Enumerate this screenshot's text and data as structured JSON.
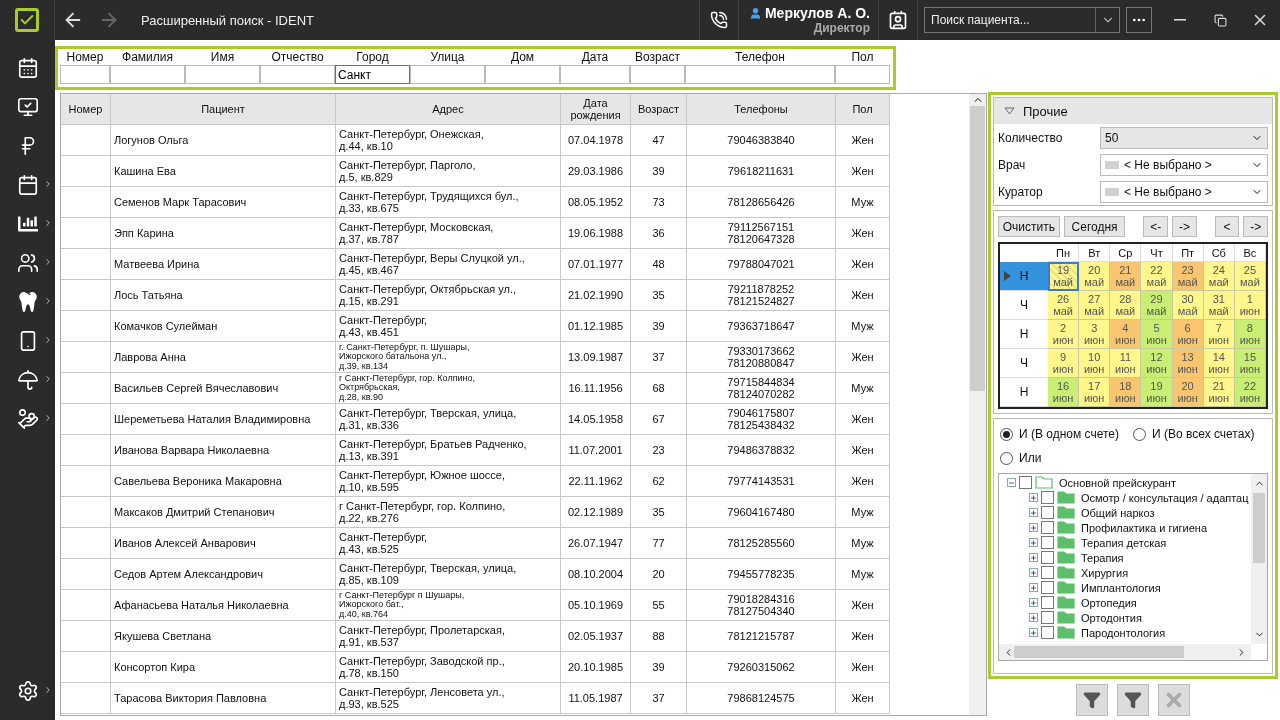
{
  "app_bar": {
    "title": "Расширенный поиск - IDENT",
    "back_disabled": false,
    "forward_disabled": true,
    "user_name": "Меркулов А. О.",
    "user_role": "Директор",
    "search": {
      "placeholder": "Поиск пациента..."
    }
  },
  "sidebar": {
    "items": [
      {
        "kind": "calendar-grid",
        "submenu": false
      },
      {
        "kind": "monitor-check",
        "submenu": false
      },
      {
        "kind": "ruble",
        "submenu": false
      },
      {
        "kind": "calendar",
        "submenu": true
      },
      {
        "kind": "chart",
        "submenu": true
      },
      {
        "kind": "people",
        "submenu": true
      },
      {
        "kind": "tooth",
        "submenu": true
      },
      {
        "kind": "phone",
        "submenu": true
      },
      {
        "kind": "umbrella",
        "submenu": true
      },
      {
        "kind": "ruble-hand",
        "submenu": true
      }
    ],
    "footer": {
      "kind": "settings",
      "submenu": true
    }
  },
  "filters": [
    {
      "label": "Номер",
      "focused": false
    },
    {
      "label": "Фамилия",
      "focused": false
    },
    {
      "label": "Имя",
      "focused": false
    },
    {
      "label": "Отчество",
      "focused": false
    },
    {
      "label": "Город",
      "value": "Санкт",
      "focused": true
    },
    {
      "label": "Улица",
      "focused": false
    },
    {
      "label": "Дом",
      "focused": false
    },
    {
      "label": "Дата",
      "focused": false
    },
    {
      "label": "Возраст",
      "focused": false
    },
    {
      "label": "Телефон",
      "focused": false
    },
    {
      "label": "Пол",
      "focused": false
    }
  ],
  "table": {
    "columns": [
      "Номер",
      "Пациент",
      "Адрес",
      "Дата рождения",
      "Возраст",
      "Телефоны",
      "Пол"
    ],
    "rows": [
      {
        "patient": "Логунов Ольга",
        "address": [
          "Санкт-Петербург, Онежская,",
          "д.44, кв.10"
        ],
        "birth_date": "07.04.1978",
        "age": "47",
        "phones": [
          "79046383840"
        ],
        "sex": "Жен"
      },
      {
        "patient": "Кашина Ева",
        "address": [
          "Санкт-Петербург, Парголо,",
          "д.5, кв.829"
        ],
        "birth_date": "29.03.1986",
        "age": "39",
        "phones": [
          "79618211631"
        ],
        "sex": "Жен"
      },
      {
        "patient": "Семенов Марк Тарасович",
        "address": [
          "Санкт-Петербург, Трудящихся бул.,",
          "д.33, кв.675"
        ],
        "birth_date": "08.05.1952",
        "age": "73",
        "phones": [
          "78128656426"
        ],
        "sex": "Муж"
      },
      {
        "patient": "Эпп Карина",
        "address": [
          "Санкт-Петербург, Московская,",
          "д.37, кв.787"
        ],
        "birth_date": "19.06.1988",
        "age": "36",
        "phones": [
          "79112567151",
          "78120647328"
        ],
        "sex": "Жен"
      },
      {
        "patient": "Матвеева Ирина",
        "address": [
          "Санкт-Петербург, Веры Слуцкой ул.,",
          "д.45, кв.467"
        ],
        "birth_date": "07.01.1977",
        "age": "48",
        "phones": [
          "79788047021"
        ],
        "sex": "Жен"
      },
      {
        "patient": "Лось Татьяна",
        "address": [
          "Санкт-Петербург, Октябрьская ул.,",
          "д.15, кв.291"
        ],
        "birth_date": "21.02.1990",
        "age": "35",
        "phones": [
          "79211878252",
          "78121524827"
        ],
        "sex": "Жен"
      },
      {
        "patient": "Комачков Сулейман",
        "address": [
          "Санкт-Петербург,",
          "д.43, кв.451"
        ],
        "birth_date": "01.12.1985",
        "age": "39",
        "phones": [
          "79363718647"
        ],
        "sex": "Муж"
      },
      {
        "patient": "Лаврова Анна",
        "address": [
          "г. Санкт-Петербург, п. Шушары,",
          "Ижорского батальона ул.,",
          "д.39, кв.134"
        ],
        "birth_date": "13.09.1987",
        "age": "37",
        "phones": [
          "79330173662",
          "78120880847"
        ],
        "sex": "Жен"
      },
      {
        "patient": "Васильев Сергей Вячеславович",
        "address": [
          "г Санкт-Петербург, гор. Колпино,",
          "Октрябрьская,",
          "д.28, кв.90"
        ],
        "birth_date": "16.11.1956",
        "age": "68",
        "phones": [
          "79715844834",
          "78124070282"
        ],
        "sex": "Муж"
      },
      {
        "patient": "Шереметьева Наталия Владимировна",
        "address": [
          "Санкт-Петербург, Тверская, улица,",
          "д.31, кв.336"
        ],
        "birth_date": "14.05.1958",
        "age": "67",
        "phones": [
          "79046175807",
          "78125438432"
        ],
        "sex": "Жен"
      },
      {
        "patient": "Иванова Варвара Николаевна",
        "address": [
          "Санкт-Петербург, Братьев Радченко,",
          "д.13, кв.391"
        ],
        "birth_date": "11.07.2001",
        "age": "23",
        "phones": [
          "79486378832"
        ],
        "sex": "Жен"
      },
      {
        "patient": "Савельева Вероника Макаровна",
        "address": [
          "Санкт-Петербург, Южное шоссе,",
          "д.10, кв.595"
        ],
        "birth_date": "22.11.1962",
        "age": "62",
        "phones": [
          "79774143531"
        ],
        "sex": "Жен"
      },
      {
        "patient": "Максаков Дмитрий Степанович",
        "address": [
          "г Санкт-Петербург, гор. Колпино,",
          "д.22, кв.276"
        ],
        "birth_date": "02.12.1989",
        "age": "35",
        "phones": [
          "79604167480"
        ],
        "sex": "Муж"
      },
      {
        "patient": "Иванов Алексей Анварович",
        "address": [
          "Санкт-Петербург,",
          "д.43, кв.525"
        ],
        "birth_date": "26.07.1947",
        "age": "77",
        "phones": [
          "78125285560"
        ],
        "sex": "Муж"
      },
      {
        "patient": "Седов Артем Александрович",
        "address": [
          "Санкт-Петербург, Тверская, улица,",
          "д.85, кв.109"
        ],
        "birth_date": "08.10.2004",
        "age": "20",
        "phones": [
          "79455778235"
        ],
        "sex": "Муж"
      },
      {
        "patient": "Афанасьева Наталья Николаевна",
        "address": [
          "г Санкт-Петербург п Шушары,",
          "Ижорского бат.,",
          "д.40, кв.764"
        ],
        "birth_date": "05.10.1969",
        "age": "55",
        "phones": [
          "79018284316",
          "78127504340"
        ],
        "sex": "Жен"
      },
      {
        "patient": "Якушева Светлана",
        "address": [
          "Санкт-Петербург, Пролетарская,",
          "д.91, кв.537"
        ],
        "birth_date": "02.05.1937",
        "age": "88",
        "phones": [
          "78121215787"
        ],
        "sex": "Жен"
      },
      {
        "patient": "Консортоп Кира",
        "address": [
          "Санкт-Петербург, Заводской  пр.,",
          "д.78, кв.150"
        ],
        "birth_date": "20.10.1985",
        "age": "39",
        "phones": [
          "79260315062"
        ],
        "sex": "Жен"
      },
      {
        "patient": "Тарасова Виктория Павловна",
        "address": [
          "Санкт-Петербург, Ленсовета ул.,",
          "д.93, кв.525"
        ],
        "birth_date": "11.05.1987",
        "age": "37",
        "phones": [
          "79868124575"
        ],
        "sex": "Жен"
      }
    ]
  },
  "other_panel": {
    "title": "Прочие",
    "expanded": true,
    "fields": [
      {
        "label": "Количество",
        "value": "50",
        "kind": "plain"
      },
      {
        "label": "Врач",
        "value": "< Не выбрано >",
        "kind": "swatch"
      },
      {
        "label": "Куратор",
        "value": "< Не выбрано >",
        "kind": "swatch"
      }
    ]
  },
  "calendar": {
    "buttons": [
      "Очистить",
      "Сегодня",
      "<-",
      "->",
      "<",
      "->"
    ],
    "weekdays": [
      "Пн",
      "Вт",
      "Ср",
      "Чт",
      "Пт",
      "Сб",
      "Вс"
    ],
    "weeks": [
      {
        "label": "Н",
        "selected": true,
        "days": [
          {
            "day": "19",
            "month": "май",
            "color": "#fff68c",
            "selected": true
          },
          {
            "day": "20",
            "month": "май",
            "color": "#fff68c",
            "selected": false
          },
          {
            "day": "21",
            "month": "май",
            "color": "#f9c56e",
            "selected": false
          },
          {
            "day": "22",
            "month": "май",
            "color": "#fff68c",
            "selected": false
          },
          {
            "day": "23",
            "month": "май",
            "color": "#f9c56e",
            "selected": false
          },
          {
            "day": "24",
            "month": "май",
            "color": "#fff68c",
            "selected": false
          },
          {
            "day": "25",
            "month": "май",
            "color": "#fff68c",
            "selected": false
          }
        ]
      },
      {
        "label": "Ч",
        "selected": false,
        "days": [
          {
            "day": "26",
            "month": "май",
            "color": "#fff68c",
            "selected": false
          },
          {
            "day": "27",
            "month": "май",
            "color": "#fff68c",
            "selected": false
          },
          {
            "day": "28",
            "month": "май",
            "color": "#fff68c",
            "selected": false
          },
          {
            "day": "29",
            "month": "май",
            "color": "#c8ef74",
            "selected": false
          },
          {
            "day": "30",
            "month": "май",
            "color": "#fff68c",
            "selected": false
          },
          {
            "day": "31",
            "month": "май",
            "color": "#fff68c",
            "selected": false
          },
          {
            "day": "1",
            "month": "июн",
            "color": "#fff68c",
            "selected": false
          }
        ]
      },
      {
        "label": "Н",
        "selected": false,
        "days": [
          {
            "day": "2",
            "month": "июн",
            "color": "#fff68c",
            "selected": false
          },
          {
            "day": "3",
            "month": "июн",
            "color": "#fff68c",
            "selected": false
          },
          {
            "day": "4",
            "month": "июн",
            "color": "#f9c56e",
            "selected": false
          },
          {
            "day": "5",
            "month": "июн",
            "color": "#c8ef74",
            "selected": false
          },
          {
            "day": "6",
            "month": "июн",
            "color": "#f9c56e",
            "selected": false
          },
          {
            "day": "7",
            "month": "июн",
            "color": "#fff68c",
            "selected": false
          },
          {
            "day": "8",
            "month": "июн",
            "color": "#c8ef74",
            "selected": false
          }
        ]
      },
      {
        "label": "Ч",
        "selected": false,
        "days": [
          {
            "day": "9",
            "month": "июн",
            "color": "#fff68c",
            "selected": false
          },
          {
            "day": "10",
            "month": "июн",
            "color": "#fff68c",
            "selected": false
          },
          {
            "day": "11",
            "month": "июн",
            "color": "#fff68c",
            "selected": false
          },
          {
            "day": "12",
            "month": "июн",
            "color": "#c8ef74",
            "selected": false
          },
          {
            "day": "13",
            "month": "июн",
            "color": "#f9c56e",
            "selected": false
          },
          {
            "day": "14",
            "month": "июн",
            "color": "#fff68c",
            "selected": false
          },
          {
            "day": "15",
            "month": "июн",
            "color": "#c8ef74",
            "selected": false
          }
        ]
      },
      {
        "label": "Н",
        "selected": false,
        "days": [
          {
            "day": "16",
            "month": "июн",
            "color": "#c8ef74",
            "selected": false
          },
          {
            "day": "17",
            "month": "июн",
            "color": "#fff68c",
            "selected": false
          },
          {
            "day": "18",
            "month": "июн",
            "color": "#f9c56e",
            "selected": false
          },
          {
            "day": "19",
            "month": "июн",
            "color": "#c8ef74",
            "selected": false
          },
          {
            "day": "20",
            "month": "июн",
            "color": "#f9c56e",
            "selected": false
          },
          {
            "day": "21",
            "month": "июн",
            "color": "#fff68c",
            "selected": false
          },
          {
            "day": "22",
            "month": "июн",
            "color": "#c8ef74",
            "selected": false
          }
        ]
      }
    ]
  },
  "match_mode": [
    {
      "label": "И (В одном счете)",
      "selected": true
    },
    {
      "label": "И (Во всех счетах)",
      "selected": false
    },
    {
      "label": "Или",
      "selected": false
    }
  ],
  "tree": {
    "label": "Основной прейскурант",
    "expanded": true,
    "checked": false,
    "children": [
      {
        "label": "Осмотр / консультация / адаптац",
        "expanded": false,
        "checked": false
      },
      {
        "label": "Общий наркоз",
        "expanded": false,
        "checked": false
      },
      {
        "label": "Профилактика и гигиена",
        "expanded": false,
        "checked": false
      },
      {
        "label": "Терапия детская",
        "expanded": false,
        "checked": false
      },
      {
        "label": "Терапия",
        "expanded": false,
        "checked": false
      },
      {
        "label": "Хирургия",
        "expanded": false,
        "checked": false
      },
      {
        "label": "Имплантология",
        "expanded": false,
        "checked": false
      },
      {
        "label": "Ортопедия",
        "expanded": false,
        "checked": false
      },
      {
        "label": "Ортодонтия",
        "expanded": false,
        "checked": false
      },
      {
        "label": "Пародонтология",
        "expanded": false,
        "checked": false
      }
    ]
  },
  "action_buttons": [
    {
      "kind": "filter-add",
      "disabled": false
    },
    {
      "kind": "filter-remove",
      "disabled": false
    },
    {
      "kind": "clear",
      "disabled": true
    }
  ]
}
